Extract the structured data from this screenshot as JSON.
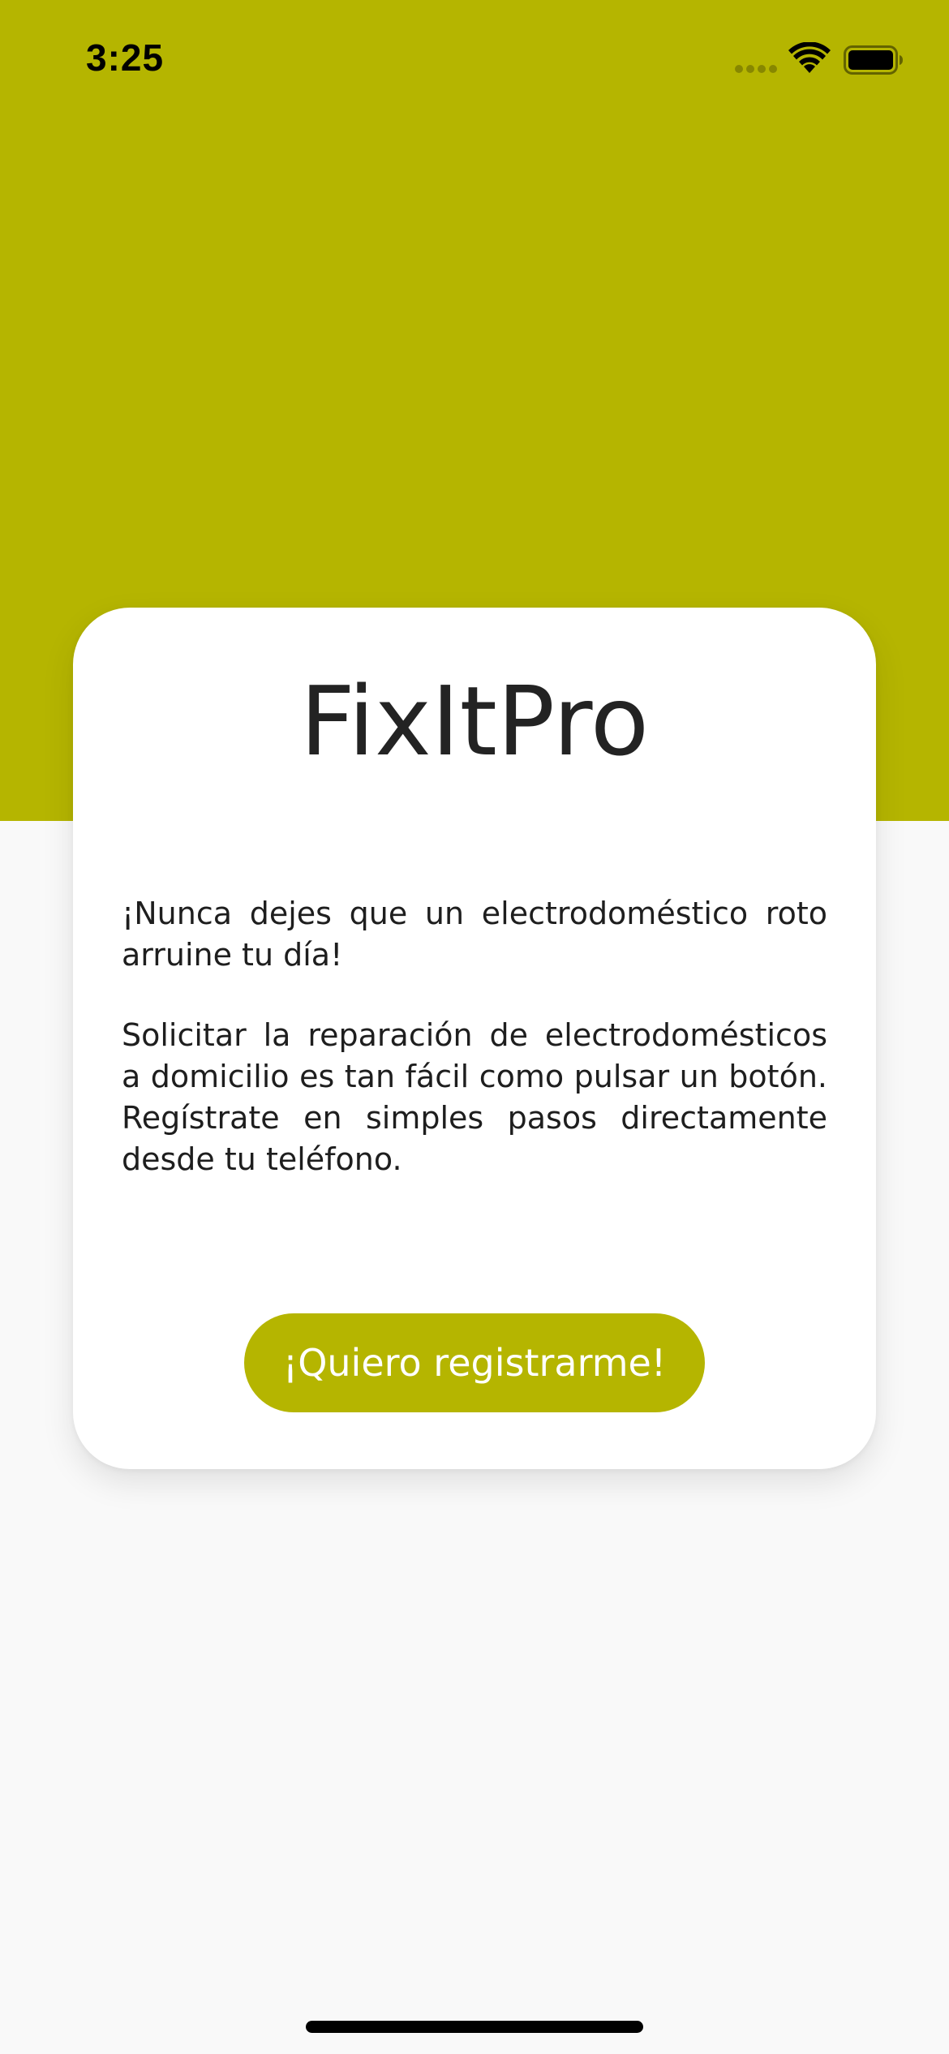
{
  "status_bar": {
    "time": "3:25",
    "icons": [
      "cellular-signal-icon",
      "wifi-icon",
      "battery-icon"
    ]
  },
  "colors": {
    "brand": "#b5b500",
    "background": "#f9f9f9",
    "card": "#ffffff",
    "text": "#1e1e1e"
  },
  "card": {
    "title": "FixItPro",
    "paragraph_1": "¡Nunca dejes que un electrodoméstico roto arruine tu día!",
    "paragraph_2": "Solicitar la reparación de electrodomésticos a domicilio es tan fácil como pulsar un botón. Regístrate en simples pasos directamente desde tu teléfono.",
    "button_label": "¡Quiero registrarme!"
  }
}
